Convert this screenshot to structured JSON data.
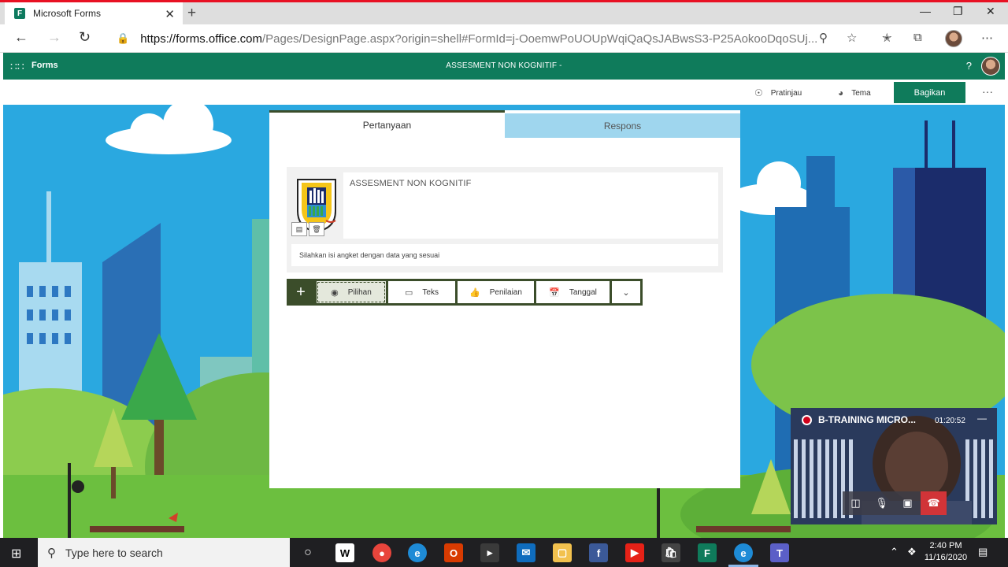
{
  "browser": {
    "tab_title": "Microsoft Forms",
    "tab_favicon": "F",
    "tab_close": "✕",
    "new_tab": "+",
    "url_host": "https://forms.office.com",
    "url_path": "/Pages/DesignPage.aspx?origin=shell#FormId=j-OoemwPoUOUpWqiQaQsJABwsS3-P25AokooDqoSUj...",
    "window_minimize": "—",
    "window_maximize": "❐",
    "window_close": "✕"
  },
  "forms_header": {
    "app_name": "Forms",
    "form_title": "ASSESMENT NON KOGNITIF -",
    "help": "?"
  },
  "command_bar": {
    "preview": "Pratinjau",
    "theme": "Tema",
    "share": "Bagikan",
    "more": "···"
  },
  "form": {
    "tabs": [
      "Pertanyaan",
      "Respons"
    ],
    "active_tab": "Pertanyaan",
    "title": "ASSESMENT NON KOGNITIF",
    "description": "Silahkan isi angket dengan data yang sesuai",
    "add_button": "+",
    "question_types": [
      {
        "label": "Pilihan",
        "icon": "radio-icon"
      },
      {
        "label": "Teks",
        "icon": "text-icon"
      },
      {
        "label": "Penilaian",
        "icon": "thumbs-up-icon"
      },
      {
        "label": "Tanggal",
        "icon": "calendar-icon"
      }
    ],
    "selected_type": "Pilihan"
  },
  "video_call": {
    "title": "B-TRAINING MICRO...",
    "time": "01:20:52",
    "minimize": "—"
  },
  "taskbar": {
    "search_placeholder": "Type here to search",
    "time": "2:40 PM",
    "date": "11/16/2020"
  },
  "colors": {
    "forms_green": "#0f7b5b",
    "accent_dark_green": "#3b4d2a",
    "sky_blue": "#2aa8e0",
    "respons_tab": "#9fd6ee",
    "end_call_red": "#d13438"
  }
}
